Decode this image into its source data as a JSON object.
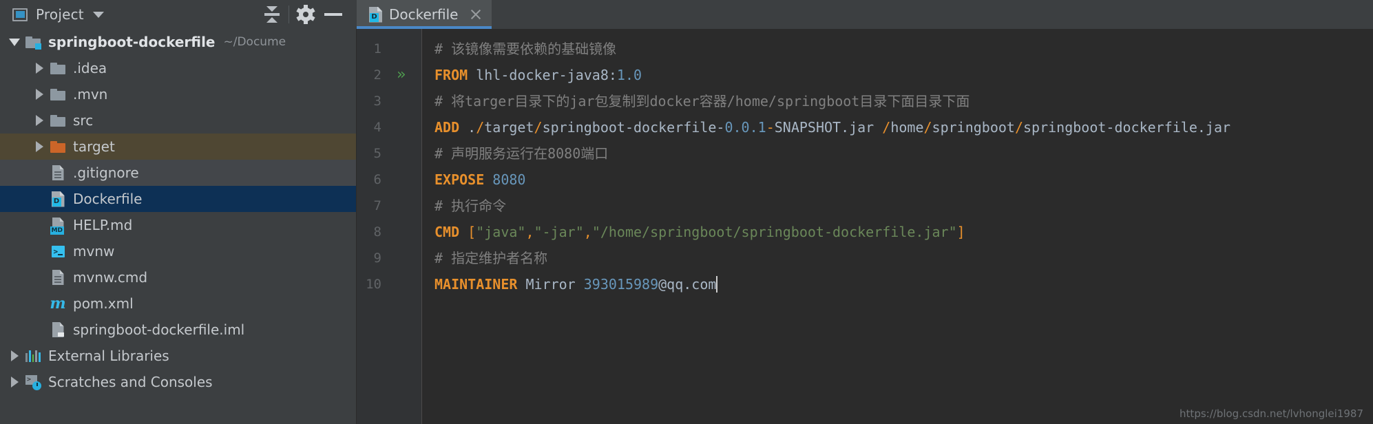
{
  "toolwindow": {
    "title": "Project",
    "icon": "project-window-icon",
    "dropdown_caret": "chevron-down-icon",
    "actions": [
      {
        "name": "collapse-all-button",
        "icon": "collapse-all-icon"
      },
      {
        "name": "settings-button",
        "icon": "gear-icon"
      },
      {
        "name": "hide-button",
        "icon": "minimize-icon"
      }
    ]
  },
  "tabs": [
    {
      "label": "Dockerfile",
      "icon": "dockerfile-icon",
      "active": true,
      "close": "close-icon"
    }
  ],
  "tree": [
    {
      "label": "springboot-dockerfile",
      "path": "~/Docume",
      "icon": "module-folder-icon",
      "twisty": "down",
      "indent": 0,
      "bold": true,
      "state": "normal"
    },
    {
      "label": ".idea",
      "icon": "folder-icon",
      "twisty": "right",
      "indent": 1,
      "state": "normal"
    },
    {
      "label": ".mvn",
      "icon": "folder-icon",
      "twisty": "right",
      "indent": 1,
      "state": "normal"
    },
    {
      "label": "src",
      "icon": "folder-icon",
      "twisty": "right",
      "indent": 1,
      "state": "normal"
    },
    {
      "label": "target",
      "icon": "folder-excluded-icon",
      "twisty": "right",
      "indent": 1,
      "state": "excluded"
    },
    {
      "label": ".gitignore",
      "icon": "text-file-icon",
      "twisty": "none",
      "indent": 1,
      "state": "soft"
    },
    {
      "label": "Dockerfile",
      "icon": "dockerfile-icon",
      "twisty": "none",
      "indent": 1,
      "state": "selected"
    },
    {
      "label": "HELP.md",
      "icon": "markdown-file-icon",
      "twisty": "none",
      "indent": 1,
      "state": "normal"
    },
    {
      "label": "mvnw",
      "icon": "shell-script-icon",
      "twisty": "none",
      "indent": 1,
      "state": "normal"
    },
    {
      "label": "mvnw.cmd",
      "icon": "text-file-icon",
      "twisty": "none",
      "indent": 1,
      "state": "normal"
    },
    {
      "label": "pom.xml",
      "icon": "maven-file-icon",
      "twisty": "none",
      "indent": 1,
      "state": "normal"
    },
    {
      "label": "springboot-dockerfile.iml",
      "icon": "iml-file-icon",
      "twisty": "none",
      "indent": 1,
      "state": "normal"
    },
    {
      "label": "External Libraries",
      "icon": "external-libraries-icon",
      "twisty": "right",
      "indent": 0,
      "state": "normal"
    },
    {
      "label": "Scratches and Consoles",
      "icon": "scratches-icon",
      "twisty": "right",
      "indent": 0,
      "state": "normal"
    }
  ],
  "editor": {
    "gutter_run_icon": "docker-run-icon",
    "gutter_run_line": 2,
    "line_numbers": [
      "1",
      "2",
      "3",
      "4",
      "5",
      "6",
      "7",
      "8",
      "9",
      "10"
    ],
    "lines": [
      {
        "n": "1",
        "tokens": [
          {
            "t": "# 该镜像需要依赖的基础镜像",
            "c": "cm"
          }
        ]
      },
      {
        "n": "2",
        "tokens": [
          {
            "t": "FROM",
            "c": "kw"
          },
          {
            "t": " lhl-docker-java8:",
            "c": "txt"
          },
          {
            "t": "1.0",
            "c": "num"
          }
        ]
      },
      {
        "n": "3",
        "tokens": [
          {
            "t": "# 将targer目录下的jar包复制到docker容器/home/springboot目录下面目录下面",
            "c": "cm"
          }
        ]
      },
      {
        "n": "4",
        "tokens": [
          {
            "t": "ADD",
            "c": "kw"
          },
          {
            "t": " .",
            "c": "txt"
          },
          {
            "t": "/",
            "c": "sep"
          },
          {
            "t": "target",
            "c": "txt"
          },
          {
            "t": "/",
            "c": "sep"
          },
          {
            "t": "springboot-dockerfile-",
            "c": "txt"
          },
          {
            "t": "0.0.1",
            "c": "num"
          },
          {
            "t": "-",
            "c": "sep"
          },
          {
            "t": "SNAPSHOT.jar ",
            "c": "txt"
          },
          {
            "t": "/",
            "c": "sep"
          },
          {
            "t": "home",
            "c": "txt"
          },
          {
            "t": "/",
            "c": "sep"
          },
          {
            "t": "springboot",
            "c": "txt"
          },
          {
            "t": "/",
            "c": "sep"
          },
          {
            "t": "springboot-dockerfile.jar",
            "c": "txt"
          }
        ]
      },
      {
        "n": "5",
        "tokens": [
          {
            "t": "# 声明服务运行在8080端口",
            "c": "cm"
          }
        ]
      },
      {
        "n": "6",
        "tokens": [
          {
            "t": "EXPOSE",
            "c": "kw"
          },
          {
            "t": " ",
            "c": "txt"
          },
          {
            "t": "8080",
            "c": "num"
          }
        ]
      },
      {
        "n": "7",
        "tokens": [
          {
            "t": "# 执行命令",
            "c": "cm"
          }
        ]
      },
      {
        "n": "8",
        "tokens": [
          {
            "t": "CMD",
            "c": "kw"
          },
          {
            "t": " [",
            "c": "sep"
          },
          {
            "t": "\"java\"",
            "c": "str"
          },
          {
            "t": ",",
            "c": "sep"
          },
          {
            "t": "\"-jar\"",
            "c": "str"
          },
          {
            "t": ",",
            "c": "sep"
          },
          {
            "t": "\"/home/springboot/springboot-dockerfile.jar\"",
            "c": "str"
          },
          {
            "t": "]",
            "c": "sep"
          }
        ]
      },
      {
        "n": "9",
        "tokens": [
          {
            "t": "# 指定维护者名称",
            "c": "cm"
          }
        ]
      },
      {
        "n": "10",
        "tokens": [
          {
            "t": "MAINTAINER",
            "c": "kw"
          },
          {
            "t": " Mirror ",
            "c": "txt"
          },
          {
            "t": "393015989",
            "c": "num"
          },
          {
            "t": "@qq.com",
            "c": "txt"
          }
        ]
      }
    ],
    "caret_line": 10
  },
  "watermark": "https://blog.csdn.net/lvhonglei1987",
  "colors": {
    "panel_bg": "#3c3f41",
    "editor_bg": "#2b2b2b",
    "gutter_bg": "#313335",
    "tab_active_bg": "#4e5254",
    "tab_underline": "#4a88c7",
    "tree_selected": "#0d3055",
    "excluded_row": "#4f4733",
    "keyword": "#e8902c",
    "number": "#6897bb",
    "string": "#6a8759",
    "comment": "#808080",
    "accent": "#27b0e0"
  }
}
